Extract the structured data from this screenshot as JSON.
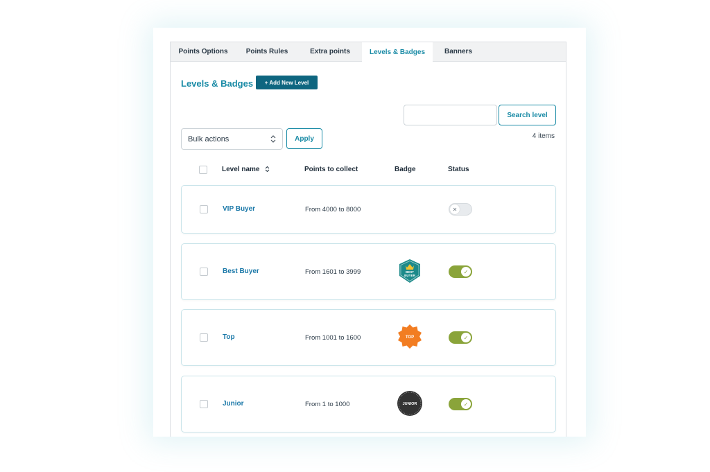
{
  "tabs": [
    {
      "label": "Points Options"
    },
    {
      "label": "Points Rules"
    },
    {
      "label": "Extra points"
    },
    {
      "label": "Levels & Badges"
    },
    {
      "label": "Banners"
    }
  ],
  "active_tab": "Levels & Badges",
  "page_title": "Levels & Badges",
  "add_button_label": "+ Add New Level",
  "search": {
    "placeholder": "",
    "value": "",
    "button_label": "Search level"
  },
  "items_count": "4 items",
  "bulk": {
    "selected": "Bulk actions",
    "apply_label": "Apply"
  },
  "columns": {
    "level_name": "Level name",
    "points": "Points to collect",
    "badge": "Badge",
    "status": "Status"
  },
  "rows": [
    {
      "name": "VIP Buyer",
      "points": "From 4000 to 8000",
      "badge": "",
      "status": "off"
    },
    {
      "name": "Best Buyer",
      "points": "From 1601 to 3999",
      "badge": "BEST BUYER",
      "status": "on"
    },
    {
      "name": "Top",
      "points": "From 1001 to 1600",
      "badge": "TOP",
      "status": "on"
    },
    {
      "name": "Junior",
      "points": "From 1 to 1000",
      "badge": "JUNIOR",
      "status": "on"
    }
  ],
  "colors": {
    "accent": "#1a8ba6",
    "primary_button": "#0e6680",
    "toggle_on": "#8aa43a",
    "badge_best_buyer": "#1d8a8a",
    "badge_top": "#f27d22",
    "badge_junior": "#333333",
    "crown": "#f2c230"
  }
}
